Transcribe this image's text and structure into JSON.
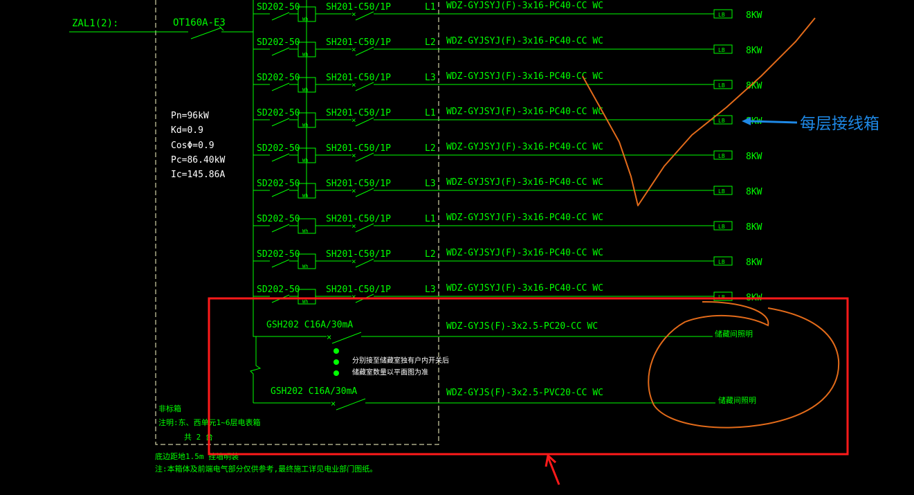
{
  "incoming": {
    "label": "ZAL1(2):",
    "main_switch": "OT160A-E3"
  },
  "params": [
    "Pn=96kW",
    "Kd=0.9",
    "CosΦ=0.9",
    "Pc=86.40kW",
    "Ic=145.86A"
  ],
  "circuits": [
    {
      "spd": "SD202-50",
      "breaker": "SH201-C50/1P",
      "phase": "L1",
      "cable": "WDZ-GYJSYJ(F)-3x16-PC40-CC WC",
      "box": "LB",
      "power": "8KW"
    },
    {
      "spd": "SD202-50",
      "breaker": "SH201-C50/1P",
      "phase": "L2",
      "cable": "WDZ-GYJSYJ(F)-3x16-PC40-CC WC",
      "box": "LB",
      "power": "8KW"
    },
    {
      "spd": "SD202-50",
      "breaker": "SH201-C50/1P",
      "phase": "L3",
      "cable": "WDZ-GYJSYJ(F)-3x16-PC40-CC WC",
      "box": "LB",
      "power": "8KW"
    },
    {
      "spd": "SD202-50",
      "breaker": "SH201-C50/1P",
      "phase": "L1",
      "cable": "WDZ-GYJSYJ(F)-3x16-PC40-CC WC",
      "box": "LB",
      "power": "8KW"
    },
    {
      "spd": "SD202-50",
      "breaker": "SH201-C50/1P",
      "phase": "L2",
      "cable": "WDZ-GYJSYJ(F)-3x16-PC40-CC WC",
      "box": "LB",
      "power": "8KW"
    },
    {
      "spd": "SD202-50",
      "breaker": "SH201-C50/1P",
      "phase": "L3",
      "cable": "WDZ-GYJSYJ(F)-3x16-PC40-CC WC",
      "box": "LB",
      "power": "8KW"
    },
    {
      "spd": "SD202-50",
      "breaker": "SH201-C50/1P",
      "phase": "L1",
      "cable": "WDZ-GYJSYJ(F)-3x16-PC40-CC WC",
      "box": "LB",
      "power": "8KW"
    },
    {
      "spd": "SD202-50",
      "breaker": "SH201-C50/1P",
      "phase": "L2",
      "cable": "WDZ-GYJSYJ(F)-3x16-PC40-CC WC",
      "box": "LB",
      "power": "8KW"
    },
    {
      "spd": "SD202-50",
      "breaker": "SH201-C50/1P",
      "phase": "L3",
      "cable": "WDZ-GYJSYJ(F)-3x16-PC40-CC WC",
      "box": "LB",
      "power": "8KW"
    }
  ],
  "meter_label": "Wh",
  "storage_circuits": [
    {
      "breaker": "GSH202 C16A/30mA",
      "cable": "WDZ-GYJS(F)-3x2.5-PC20-CC WC",
      "load": "储藏间照明"
    },
    {
      "breaker": "GSH202 C16A/30mA",
      "cable": "WDZ-GYJS(F)-3x2.5-PVC20-CC WC",
      "load": "储藏间照明"
    }
  ],
  "storage_note": [
    "分别接至储藏室独有户内开关后",
    "储藏室数量以平面图为准"
  ],
  "box_notes": {
    "type": "非标箱",
    "note": "注明:东、西单元1~6层电表箱",
    "count": "共 2 台",
    "mount": "底边距地1.5m 挂墙明装",
    "footer": "注:本箱体及前端电气部分仅供参考,最终施工详见电业部门图纸。"
  },
  "annotation": {
    "text": "每层接线箱",
    "color": "#1e88e5"
  },
  "colors": {
    "line": "#00ff00",
    "text": "#00ff00",
    "dashed": "#ffffcc",
    "white_text": "#ffffff",
    "highlight_box": "#ff1a1a",
    "markup": "#e36b1a",
    "bullet": "#00ff00"
  }
}
